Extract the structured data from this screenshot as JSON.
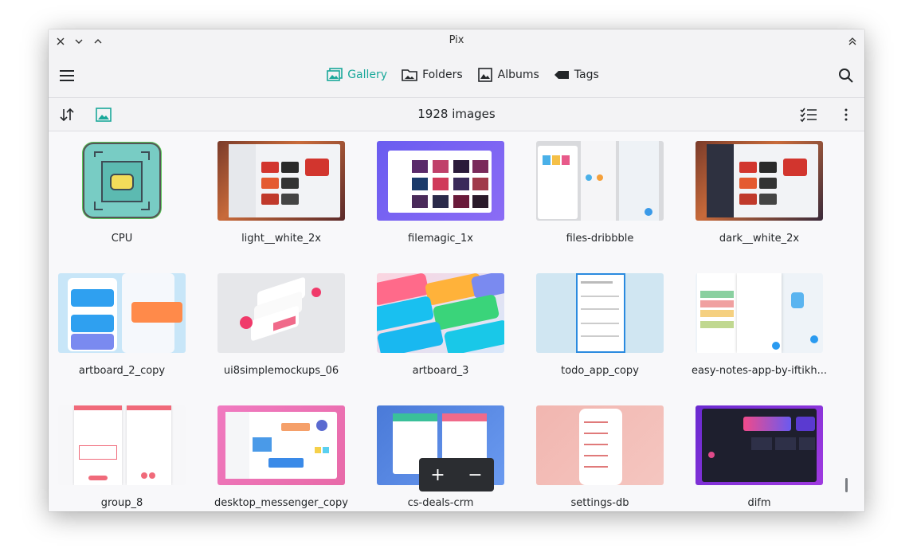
{
  "window": {
    "title": "Pix"
  },
  "views": [
    {
      "label": "Gallery",
      "icon": "gallery-icon",
      "active": true
    },
    {
      "label": "Folders",
      "icon": "folder-icon",
      "active": false
    },
    {
      "label": "Albums",
      "icon": "album-icon",
      "active": false
    },
    {
      "label": "Tags",
      "icon": "tag-icon",
      "active": false
    }
  ],
  "status": {
    "count_label": "1928 images"
  },
  "accent_color": "#1aa89a",
  "gallery": {
    "items": [
      {
        "name": "CPU"
      },
      {
        "name": "light__white_2x"
      },
      {
        "name": "filemagic_1x"
      },
      {
        "name": "files-dribbble"
      },
      {
        "name": "dark__white_2x"
      },
      {
        "name": "artboard_2_copy"
      },
      {
        "name": "ui8simplemockups_06"
      },
      {
        "name": "artboard_3"
      },
      {
        "name": "todo_app_copy"
      },
      {
        "name": "easy-notes-app-by-iftikh..."
      },
      {
        "name": "group_8"
      },
      {
        "name": "desktop_messenger_copy"
      },
      {
        "name": "cs-deals-crm"
      },
      {
        "name": "settings-db"
      },
      {
        "name": "difm"
      }
    ]
  },
  "zoom": {
    "in_label": "+",
    "out_label": "−"
  }
}
